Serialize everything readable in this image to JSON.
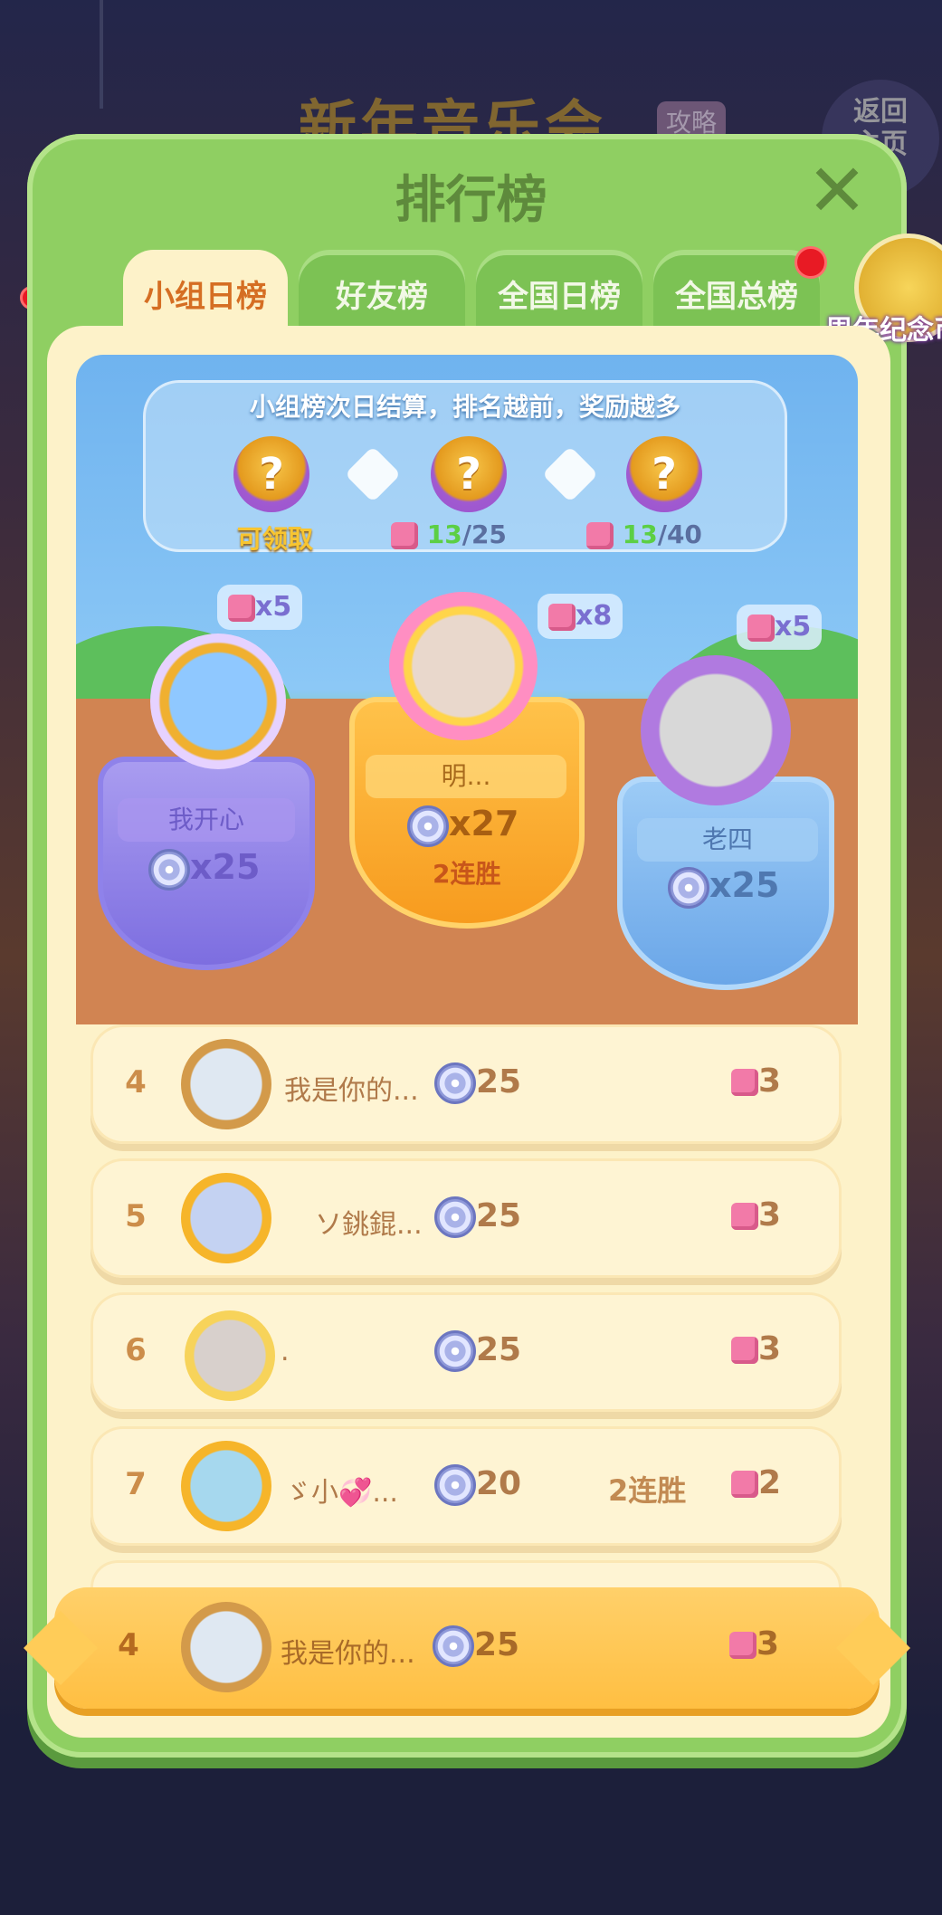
{
  "background": {
    "event_title": "新年音乐会",
    "event_tag": "攻略",
    "return_button": "返回\n主页"
  },
  "modal": {
    "title": "排行榜",
    "close_icon": "close-icon"
  },
  "tabs": [
    {
      "label": "小组日榜",
      "active": true
    },
    {
      "label": "好友榜",
      "active": false
    },
    {
      "label": "全国日榜",
      "active": false
    },
    {
      "label": "全国总榜",
      "active": false
    }
  ],
  "anniversary": {
    "label": "周年纪念币"
  },
  "settlement": {
    "info": "小组榜次日结算，排名越前，奖励越多",
    "rewards": [
      {
        "label": "可领取"
      },
      {
        "current": "13",
        "total": "/25"
      },
      {
        "current": "13",
        "total": "/40"
      }
    ]
  },
  "podium": [
    {
      "place": 1,
      "name": "明...",
      "score": "x27",
      "streak": "2连胜",
      "puzzle": "x8"
    },
    {
      "place": 2,
      "name": "我开心",
      "score": "x25",
      "puzzle": "x5"
    },
    {
      "place": 3,
      "name": "老四",
      "score": "x25",
      "puzzle": "x5"
    }
  ],
  "rows": [
    {
      "rank": "4",
      "name": "我是你的...",
      "score": "25",
      "streak": "",
      "puzzle": "3"
    },
    {
      "rank": "5",
      "name": "ソ銚錕...",
      "score": "25",
      "streak": "",
      "puzzle": "3"
    },
    {
      "rank": "6",
      "name": ".",
      "score": "25",
      "streak": "",
      "puzzle": "3"
    },
    {
      "rank": "7",
      "name": "ゞ小💞...",
      "score": "20",
      "streak": "2连胜",
      "puzzle": "2"
    }
  ],
  "my_row": {
    "rank": "4",
    "name": "我是你的...",
    "score": "25",
    "puzzle": "3"
  },
  "colors": {
    "modal_green": "#8fcf62",
    "active_tab_text": "#d56e23",
    "gold": "#ffbf42"
  }
}
